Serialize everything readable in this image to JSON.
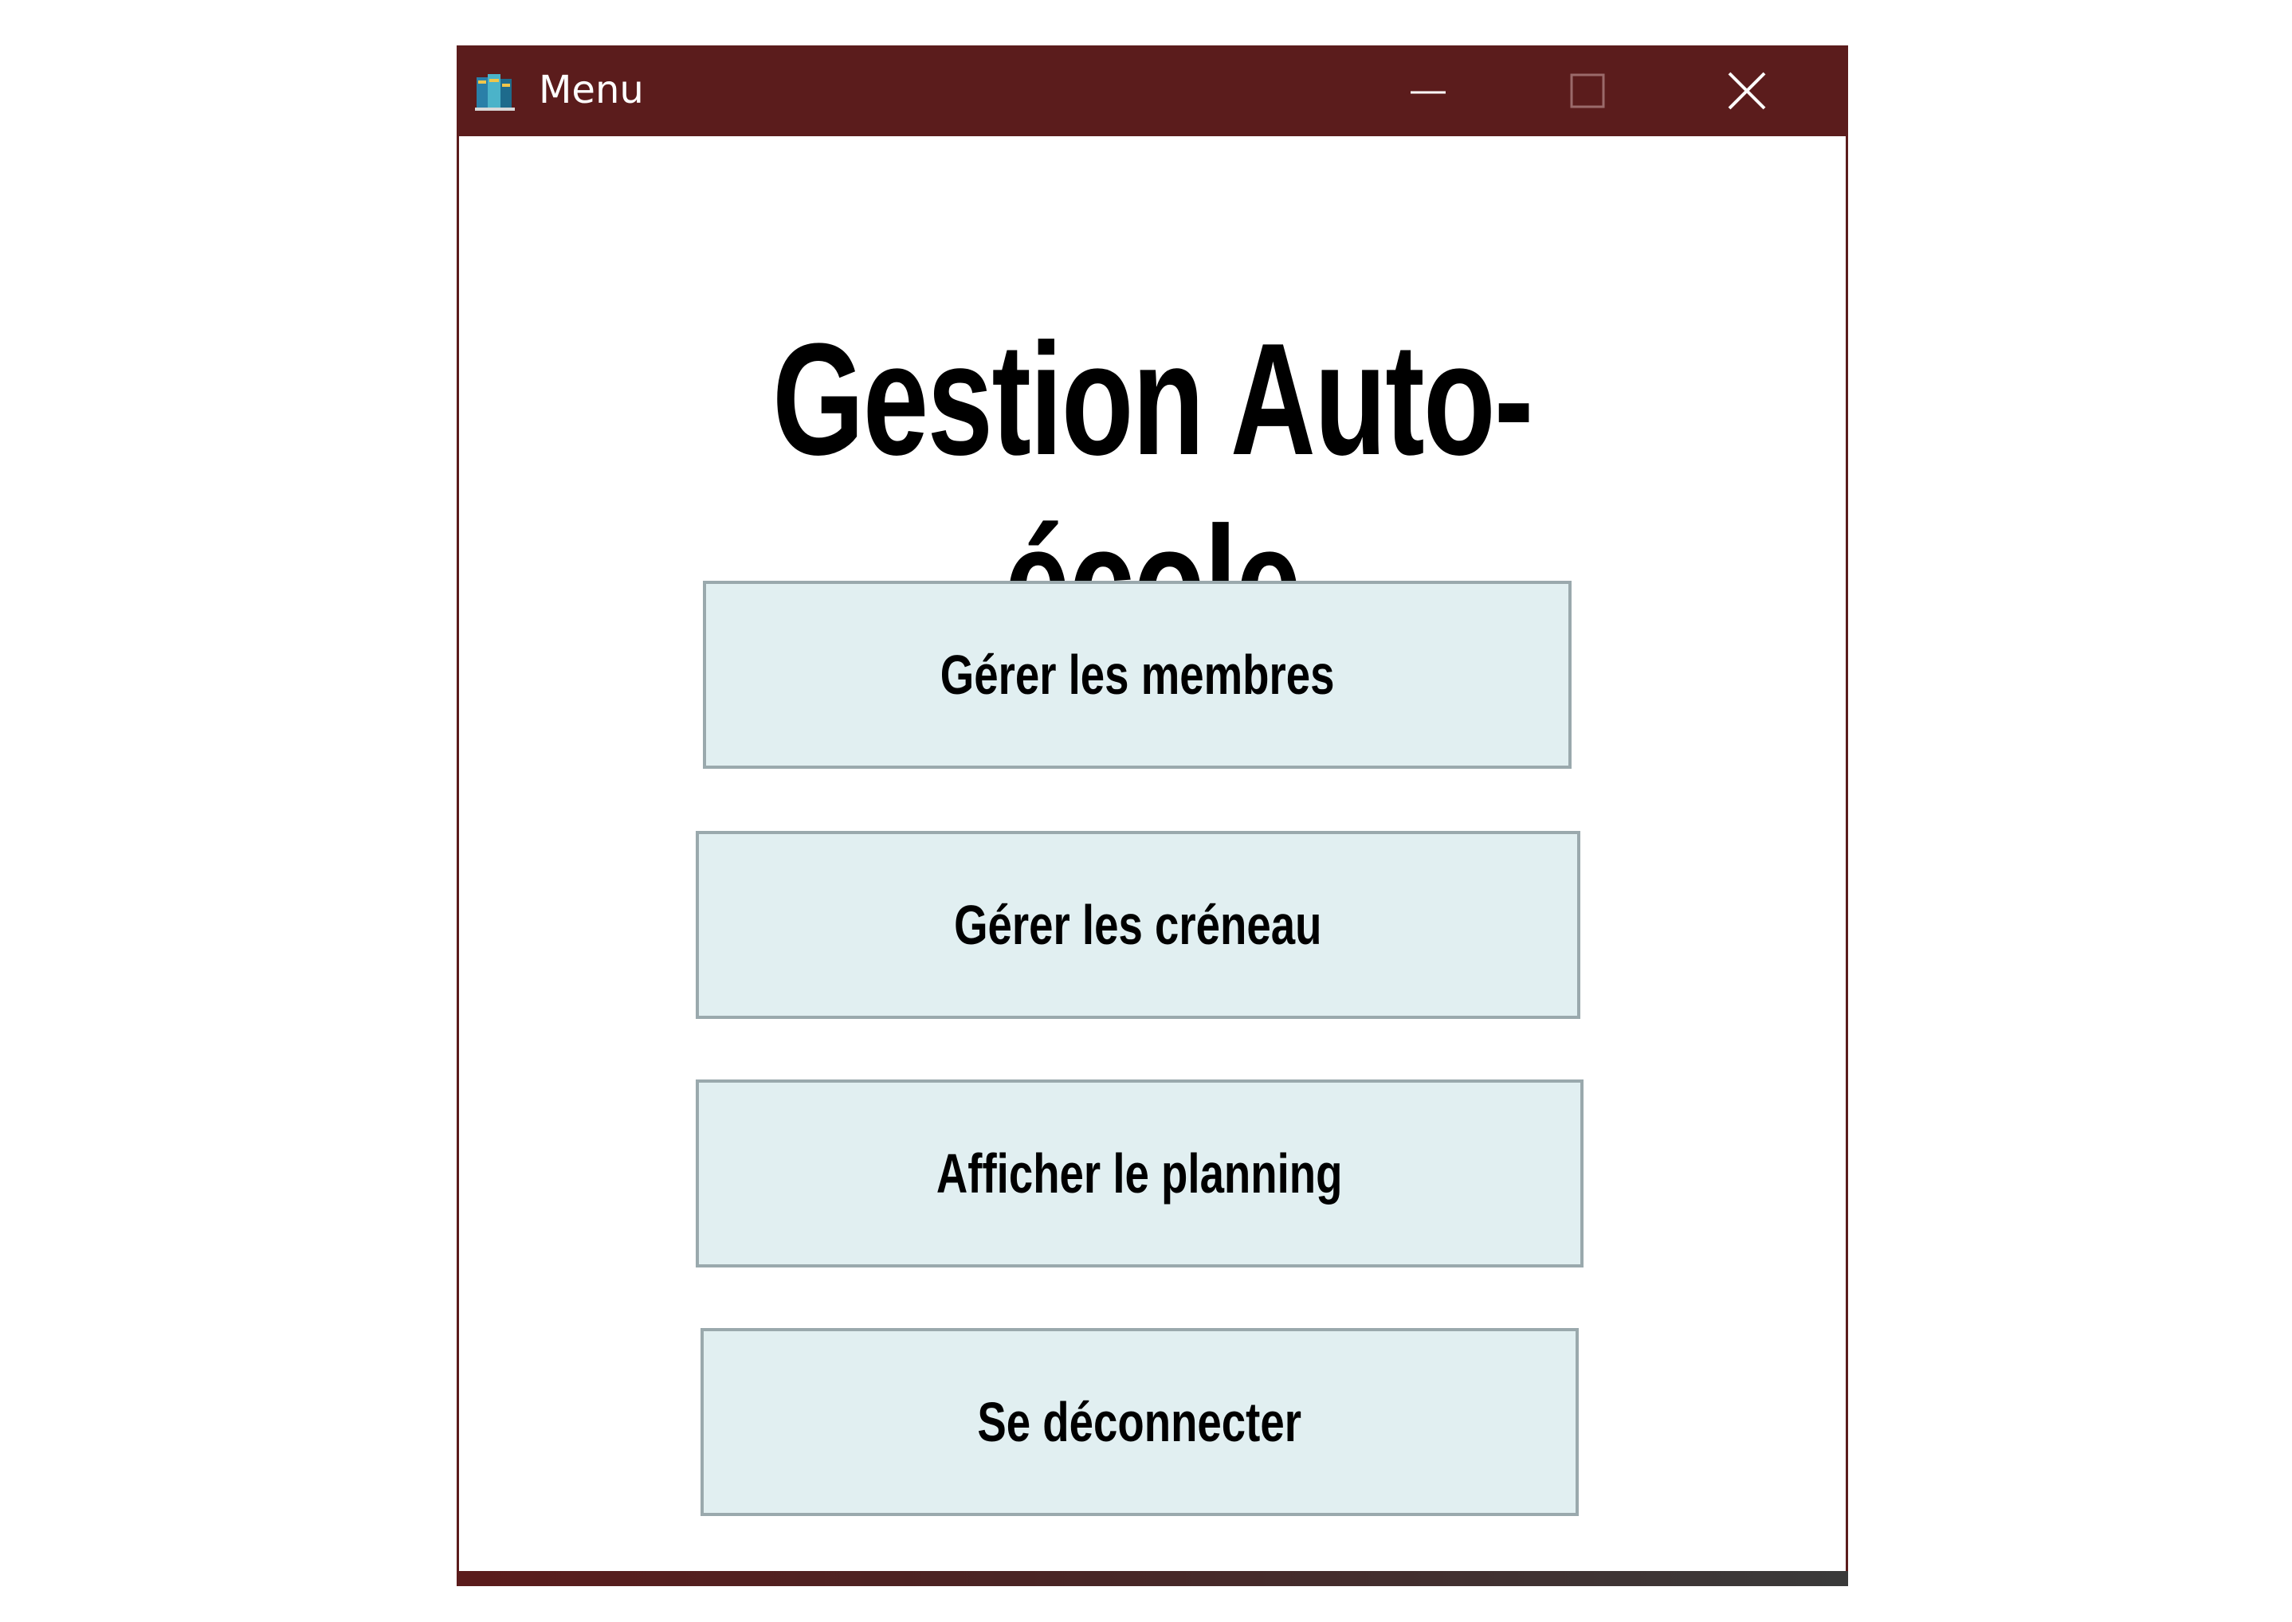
{
  "window": {
    "title": "Menu",
    "icon": "book-stack-icon",
    "controls": {
      "minimize_icon": "minimize-icon",
      "maximize_icon": "maximize-icon",
      "close_icon": "close-icon"
    },
    "titlebar_color": "#5b1c1c"
  },
  "main": {
    "heading": "Gestion Auto-école",
    "buttons": [
      {
        "label": "Gérer les membres"
      },
      {
        "label": "Gérer les créneau"
      },
      {
        "label": "Afficher le planning"
      },
      {
        "label": "Se déconnecter"
      }
    ],
    "button_color": "#e1eff1",
    "button_border_color": "#9aa9ad"
  }
}
